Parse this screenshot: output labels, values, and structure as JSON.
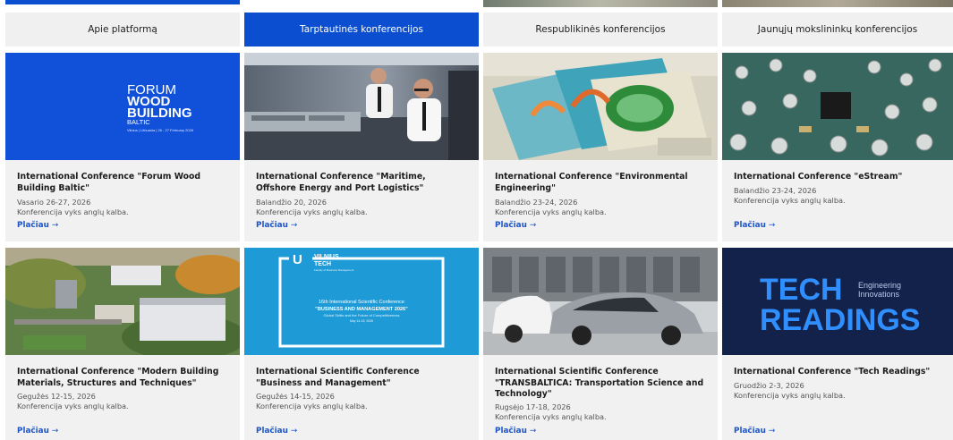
{
  "tabs": [
    {
      "label": "Apie platformą",
      "active": false
    },
    {
      "label": "Tarptautinės konferencijos",
      "active": true
    },
    {
      "label": "Respublikinės konferencijos",
      "active": false
    },
    {
      "label": "Jaunųjų mokslininkų konferencijos",
      "active": false
    }
  ],
  "more_label": "Plačiau",
  "more_arrow": "→",
  "cards": [
    {
      "title": "International Conference \"Forum Wood Building Baltic\"",
      "date": "Vasario 26-27, 2026",
      "note": "Konferencija vyks anglų kalba.",
      "image": {
        "kind": "forum-wood-logo",
        "bg": "#1150d8",
        "logo_line1": "FORUM",
        "logo_line2": "WOOD",
        "logo_line3": "BUILDING",
        "logo_line4": "BALTIC",
        "logo_sub": "Vilnius | Lithuania | 26 - 27 February 2026"
      }
    },
    {
      "title": "International Conference \"Maritime, Offshore Energy and Port Logistics\"",
      "date": "Balandžio 20, 2026",
      "note": "Konferencija vyks anglų kalba.",
      "image": {
        "kind": "photo-ship-bridge"
      }
    },
    {
      "title": "International Conference \"Environmental Engineering\"",
      "date": "Balandžio 23-24, 2026",
      "note": "Konferencija vyks anglų kalba.",
      "image": {
        "kind": "photo-books"
      }
    },
    {
      "title": "International Conference \"eStream\"",
      "date": "Balandžio 23-24, 2026",
      "note": "Konferencija vyks anglų kalba.",
      "image": {
        "kind": "photo-circuit-board"
      }
    },
    {
      "title": "International Conference \"Modern Building Materials, Structures and Techniques\"",
      "date": "Gegužės 12-15, 2026",
      "note": "Konferencija vyks anglų kalba.",
      "image": {
        "kind": "photo-campus-aerial"
      }
    },
    {
      "title": "International Scientific Conference \"Business and Management\"",
      "date": "Gegužės 14-15, 2026",
      "note": "Konferencija vyks anglų kalba.",
      "image": {
        "kind": "vilnius-tech-banner",
        "bg": "#1e9ad6",
        "brand_line1": "VILNIUS",
        "brand_line2": "TECH",
        "brand_sub": "Faculty of Business Management",
        "conf_line1": "16th International Scientific Conference",
        "conf_line2": "\"BUSINESS AND MANAGEMENT 2026\"",
        "conf_line3": "Global Shifts and the Future of Competitiveness",
        "conf_line4": "May 14-15, 2026"
      }
    },
    {
      "title": "International Scientific Conference \"TRANSBALTICA: Transportation Science and Technology\"",
      "date": "Rugsėjo 17-18, 2026",
      "note": "Konferencija vyks anglų kalba.",
      "image": {
        "kind": "photo-cars"
      }
    },
    {
      "title": "International Conference \"Tech Readings\"",
      "date": "Gruodžio 2-3, 2026",
      "note": "Konferencija vyks anglų kalba.",
      "image": {
        "kind": "tech-readings-logo",
        "bg": "#13224a",
        "line1": "TECH",
        "line2": "READINGS",
        "side1": "Engineering",
        "side2": "Innovations"
      }
    }
  ],
  "colors": {
    "accent": "#0b4fd0",
    "link": "#1d55c8",
    "tab_bg": "#f0f0f0",
    "card_bg": "#f1f1f1"
  }
}
